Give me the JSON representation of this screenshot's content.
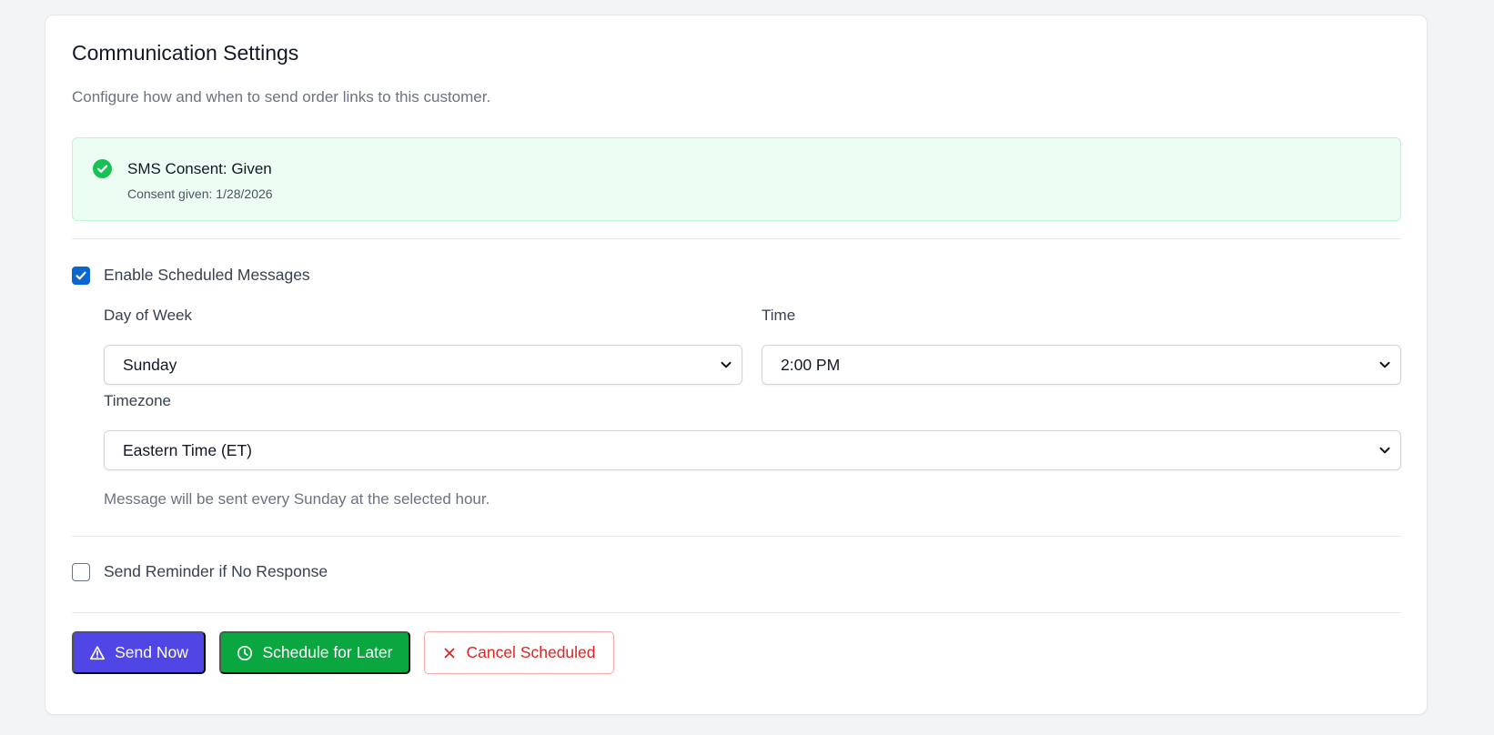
{
  "header": {
    "title": "Communication Settings",
    "subtitle": "Configure how and when to send order links to this customer."
  },
  "consent": {
    "title": "SMS Consent: Given",
    "date_text": "Consent given: 1/28/2026",
    "icon": "check-circle-icon",
    "color": "#16a34a"
  },
  "schedule": {
    "enabled_label": "Enable Scheduled Messages",
    "enabled": true,
    "day_label": "Day of Week",
    "day_value": "Sunday",
    "time_label": "Time",
    "time_value": "2:00 PM",
    "timezone_label": "Timezone",
    "timezone_value": "Eastern Time (ET)",
    "hint": "Message will be sent every Sunday at the selected hour."
  },
  "reminder": {
    "label": "Send Reminder if No Response",
    "enabled": false
  },
  "actions": {
    "send_now": "Send Now",
    "schedule_later": "Schedule for Later",
    "cancel_scheduled": "Cancel Scheduled"
  },
  "colors": {
    "primary": "#4f46e5",
    "success": "#0aa63f",
    "danger": "#dc2626",
    "checkbox": "#0b67d0"
  }
}
